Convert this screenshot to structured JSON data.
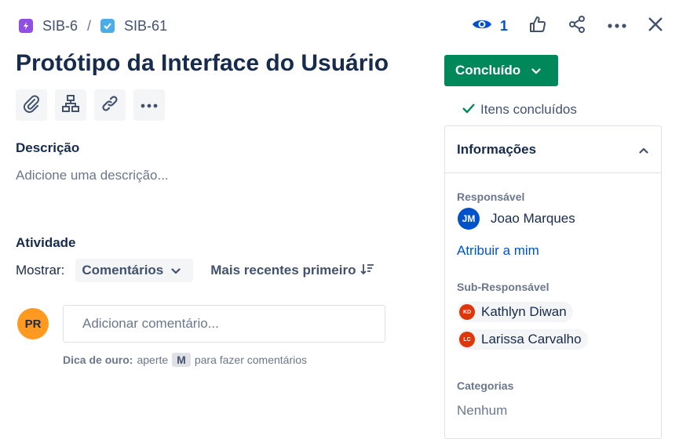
{
  "breadcrumb": {
    "parent_key": "SIB-6",
    "separator": "/",
    "issue_key": "SIB-61",
    "parent_icon": "epic-icon",
    "issue_icon": "task-icon"
  },
  "header_actions": {
    "watch_count": "1",
    "icons": [
      "eye-icon",
      "thumbs-up-icon",
      "share-icon",
      "more-icon",
      "close-icon"
    ]
  },
  "issue": {
    "title": "Protótipo da Interface do Usuário",
    "tool_icons": [
      "attachment-icon",
      "child-issue-icon",
      "link-icon",
      "more-icon"
    ]
  },
  "description": {
    "label": "Descrição",
    "placeholder": "Adicione uma descrição..."
  },
  "activity": {
    "label": "Atividade",
    "show_label": "Mostrar:",
    "show_value": "Comentários",
    "sort_label": "Mais recentes primeiro",
    "user_initials": "PR",
    "comment_placeholder": "Adicionar comentário...",
    "tip_bold": "Dica de ouro:",
    "tip_before": "aperte",
    "tip_key": "M",
    "tip_after": "para fazer comentários"
  },
  "status": {
    "label": "Concluído",
    "resolution": "Itens concluídos",
    "color": "#00875a"
  },
  "details": {
    "header": "Informações",
    "assignee_label": "Responsável",
    "assignee_initials": "JM",
    "assignee_name": "Joao Marques",
    "assign_to_me": "Atribuir a mim",
    "sub_assignee_label": "Sub-Responsável",
    "sub_assignees": [
      {
        "initials": "KD",
        "name": "Kathlyn Diwan"
      },
      {
        "initials": "LC",
        "name": "Larissa Carvalho"
      }
    ],
    "categories_label": "Categorias",
    "categories_value": "Nenhum"
  }
}
